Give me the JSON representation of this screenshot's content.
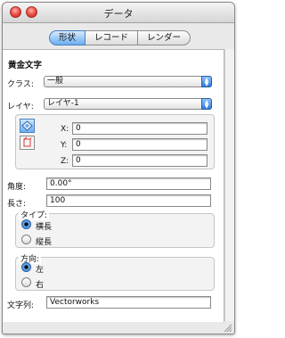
{
  "window": {
    "title": "データ"
  },
  "tabs": [
    {
      "label": "形状",
      "active": true
    },
    {
      "label": "レコード",
      "active": false
    },
    {
      "label": "レンダー",
      "active": false
    }
  ],
  "object_type": "黄金文字",
  "class": {
    "label": "クラス:",
    "value": "一般"
  },
  "layer": {
    "label": "レイヤ:",
    "value": "レイヤ-1"
  },
  "position": {
    "x_label": "X:",
    "x_value": "0",
    "y_label": "Y:",
    "y_value": "0",
    "z_label": "Z:",
    "z_value": "0"
  },
  "angle": {
    "label": "角度:",
    "value": "0.00°"
  },
  "length": {
    "label": "長さ:",
    "value": "100"
  },
  "type_group": {
    "label": "タイプ:",
    "options": [
      "横長",
      "縦長"
    ],
    "selected": "横長"
  },
  "direction_group": {
    "label": "方向:",
    "options": [
      "左",
      "右"
    ],
    "selected": "左"
  },
  "text_string": {
    "label": "文字列:",
    "value": "Vectorworks"
  },
  "colors": {
    "accent": "#2f78e0",
    "tab_active": "#6aaef2",
    "close": "#e9463c"
  }
}
